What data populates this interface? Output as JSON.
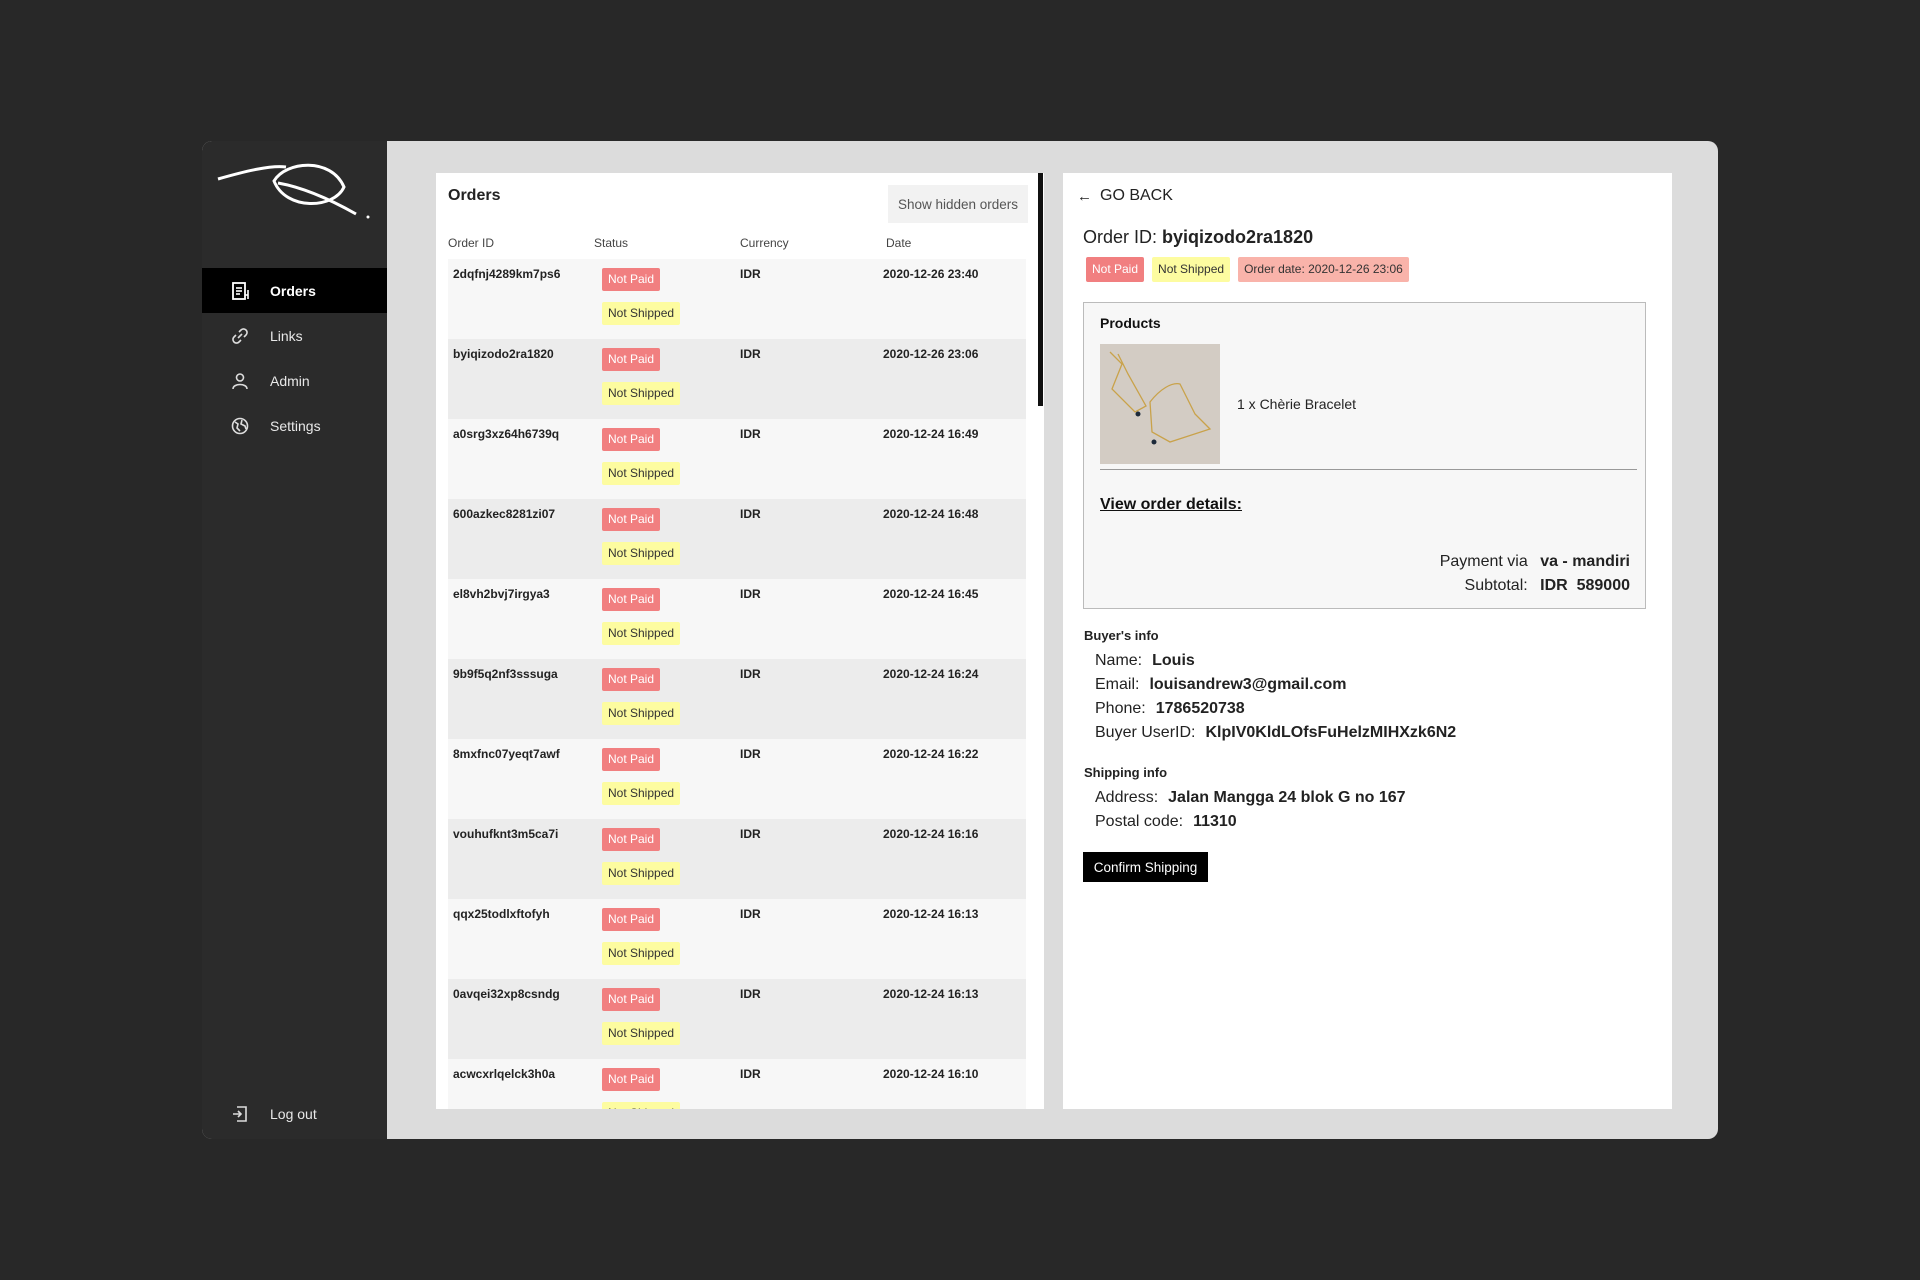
{
  "sidebar": {
    "items": [
      {
        "label": "Orders",
        "icon": "orders-icon",
        "active": true
      },
      {
        "label": "Links",
        "icon": "link-icon"
      },
      {
        "label": "Admin",
        "icon": "user-icon"
      },
      {
        "label": "Settings",
        "icon": "globe-icon"
      }
    ],
    "logout_label": "Log out"
  },
  "orders": {
    "title": "Orders",
    "show_hidden_label": "Show hidden orders",
    "columns": [
      "Order ID",
      "Status",
      "Currency",
      "Date"
    ],
    "rows": [
      {
        "id": "2dqfnj4289km7ps6",
        "paid": "Not Paid",
        "shipped": "Not Shipped",
        "currency": "IDR",
        "date": "2020-12-26 23:40"
      },
      {
        "id": "byiqizodo2ra1820",
        "paid": "Not Paid",
        "shipped": "Not Shipped",
        "currency": "IDR",
        "date": "2020-12-26 23:06"
      },
      {
        "id": "a0srg3xz64h6739q",
        "paid": "Not Paid",
        "shipped": "Not Shipped",
        "currency": "IDR",
        "date": "2020-12-24 16:49"
      },
      {
        "id": "600azkec8281zi07",
        "paid": "Not Paid",
        "shipped": "Not Shipped",
        "currency": "IDR",
        "date": "2020-12-24 16:48"
      },
      {
        "id": "el8vh2bvj7irgya3",
        "paid": "Not Paid",
        "shipped": "Not Shipped",
        "currency": "IDR",
        "date": "2020-12-24 16:45"
      },
      {
        "id": "9b9f5q2nf3sssuga",
        "paid": "Not Paid",
        "shipped": "Not Shipped",
        "currency": "IDR",
        "date": "2020-12-24 16:24"
      },
      {
        "id": "8mxfnc07yeqt7awf",
        "paid": "Not Paid",
        "shipped": "Not Shipped",
        "currency": "IDR",
        "date": "2020-12-24 16:22"
      },
      {
        "id": "vouhufknt3m5ca7i",
        "paid": "Not Paid",
        "shipped": "Not Shipped",
        "currency": "IDR",
        "date": "2020-12-24 16:16"
      },
      {
        "id": "qqx25todlxftofyh",
        "paid": "Not Paid",
        "shipped": "Not Shipped",
        "currency": "IDR",
        "date": "2020-12-24 16:13"
      },
      {
        "id": "0avqei32xp8csndg",
        "paid": "Not Paid",
        "shipped": "Not Shipped",
        "currency": "IDR",
        "date": "2020-12-24 16:13"
      },
      {
        "id": "acwcxrlqelck3h0a",
        "paid": "Not Paid",
        "shipped": "Not Shipped",
        "currency": "IDR",
        "date": "2020-12-24 16:10"
      }
    ]
  },
  "detail": {
    "go_back_label": "GO BACK",
    "order_id_label": "Order ID:",
    "order_id": "byiqizodo2ra1820",
    "badges": {
      "paid": "Not Paid",
      "shipped": "Not Shipped",
      "order_date": "Order date: 2020-12-26 23:06"
    },
    "products_title": "Products",
    "product_line": "1 x Chèrie Bracelet",
    "view_details_label": "View order details:",
    "payment_label": "Payment via",
    "payment_value": "va - mandiri",
    "subtotal_label": "Subtotal:",
    "subtotal_value": "IDR  589000",
    "buyer_title": "Buyer's info",
    "buyer": {
      "name_label": "Name:",
      "name": "Louis",
      "email_label": "Email:",
      "email": "louisandrew3@gmail.com",
      "phone_label": "Phone:",
      "phone": "1786520738",
      "userid_label": "Buyer UserID:",
      "userid": "KlpIV0KldLOfsFuHelzMIHXzk6N2"
    },
    "shipping_title": "Shipping info",
    "shipping": {
      "address_label": "Address:",
      "address": "Jalan Mangga 24 blok G no 167",
      "postal_label": "Postal code:",
      "postal": "11310"
    },
    "confirm_label": "Confirm Shipping"
  }
}
